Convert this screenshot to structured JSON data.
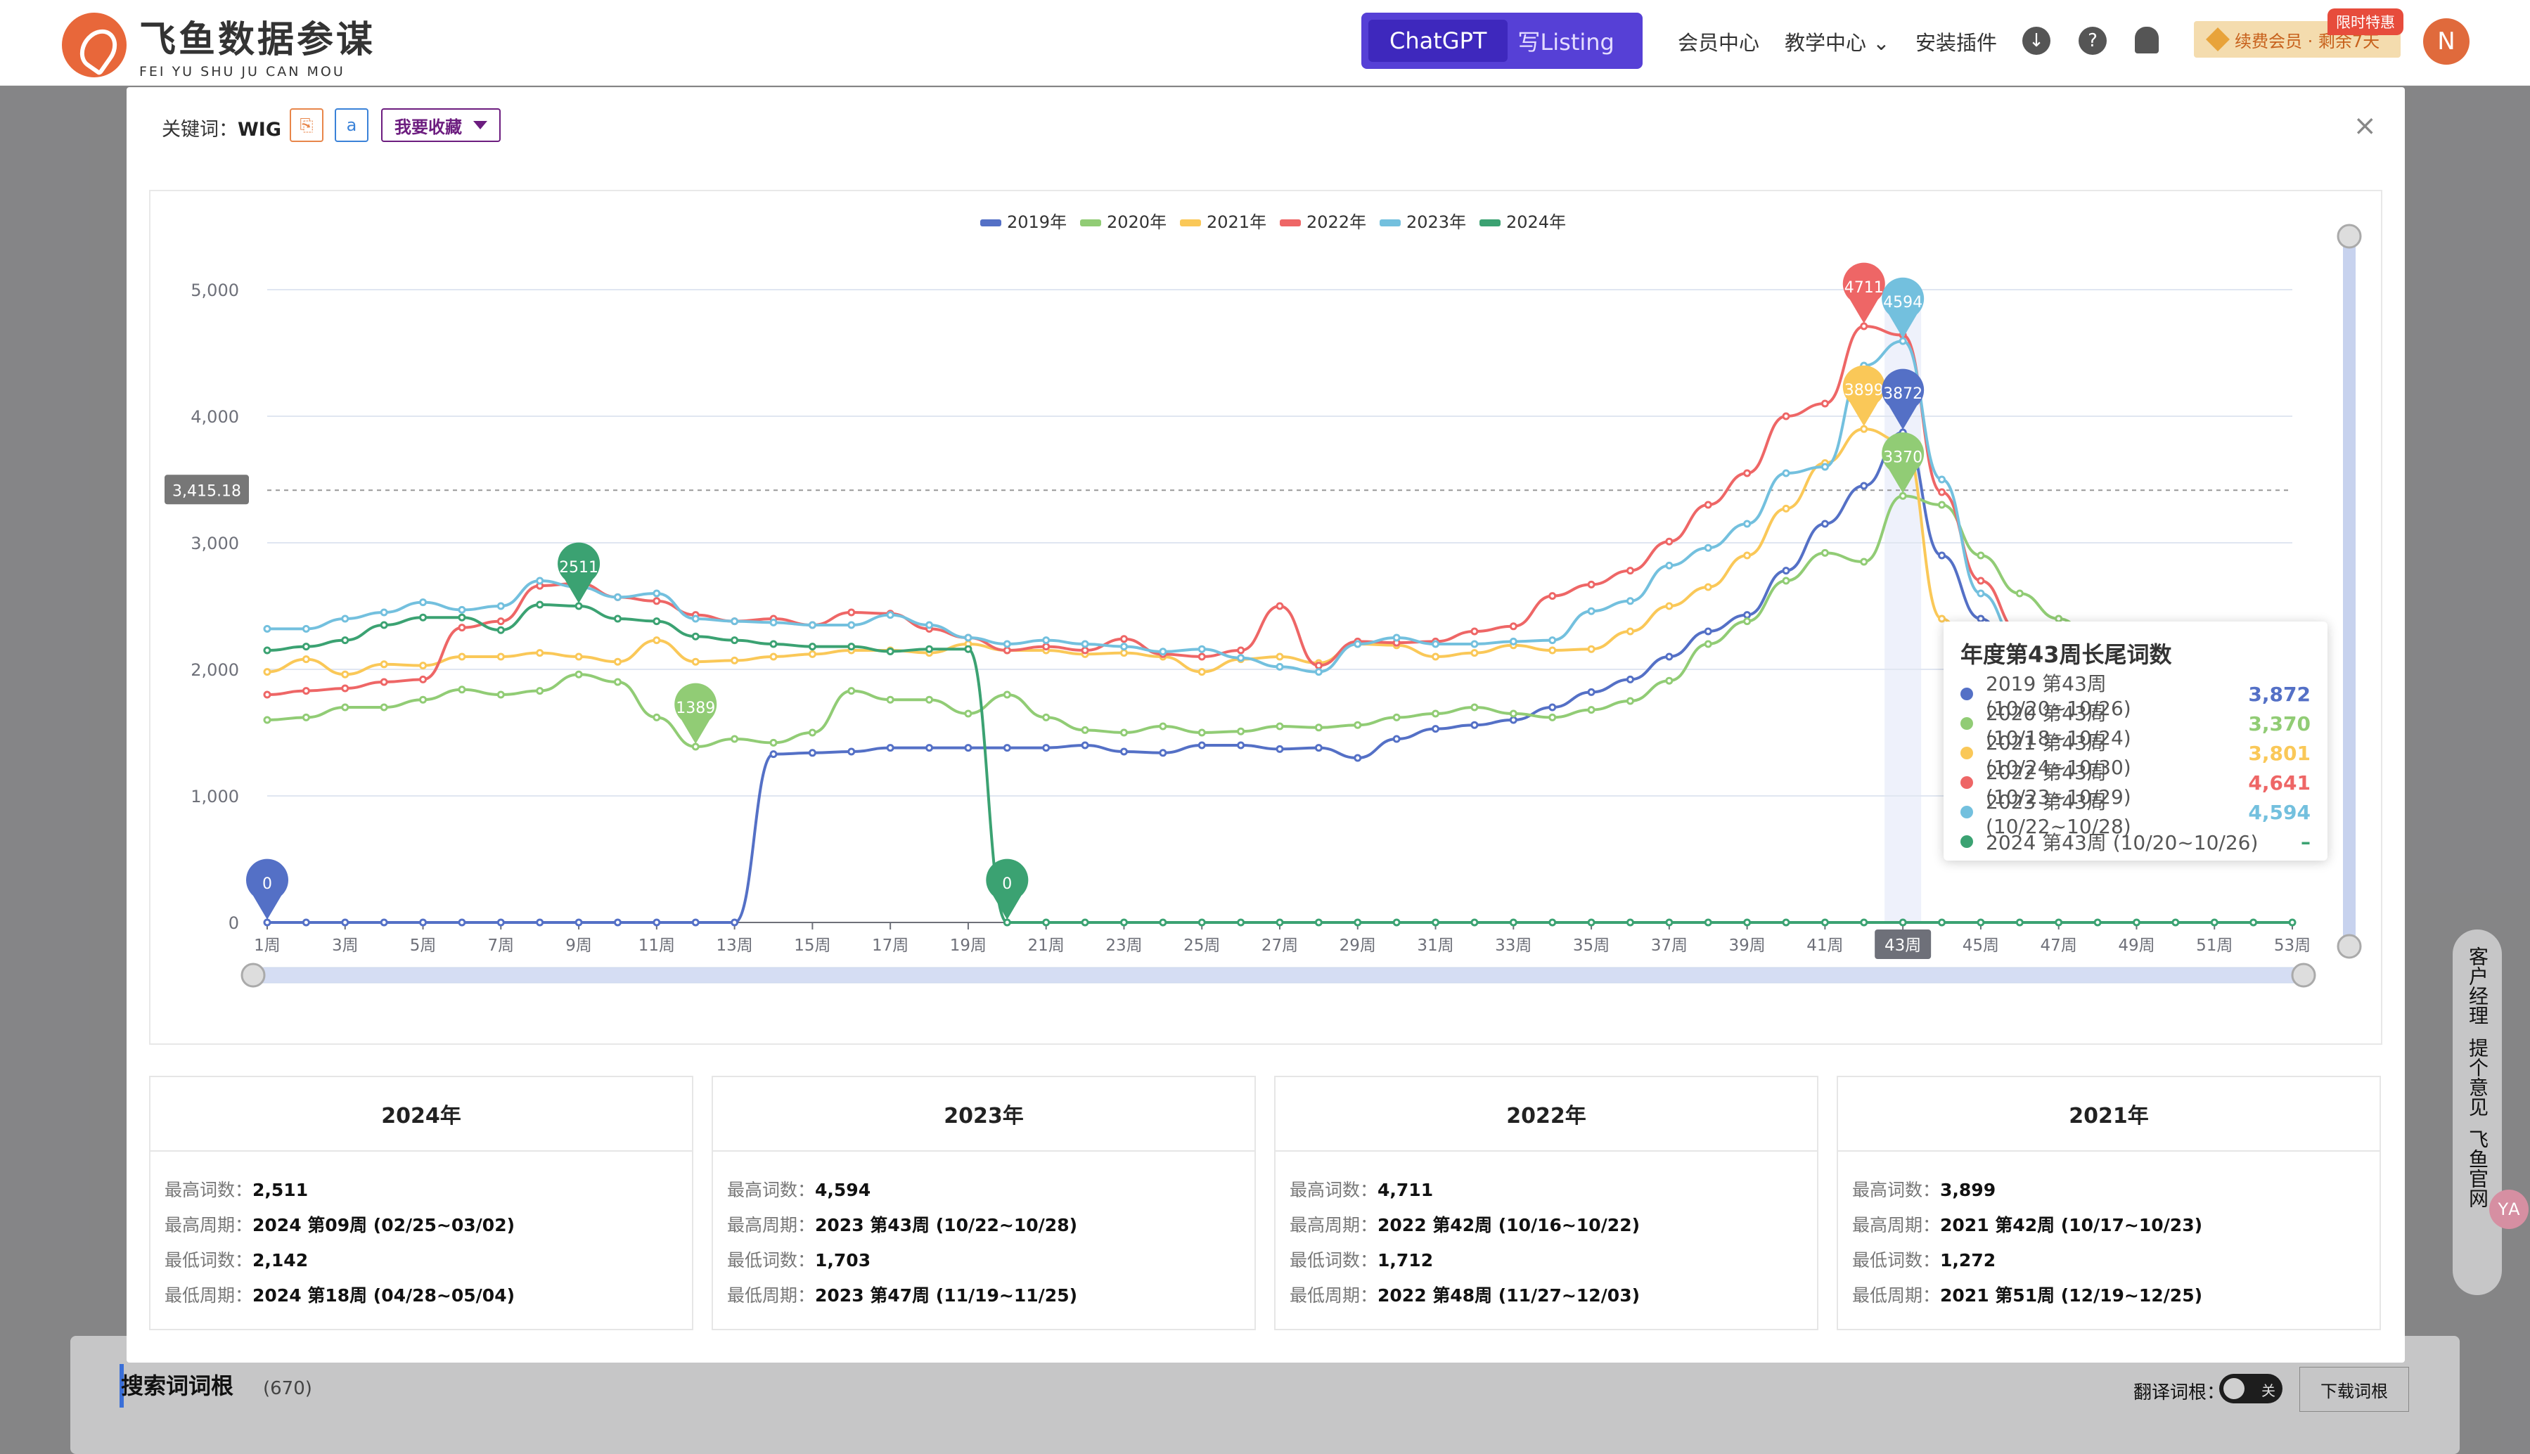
{
  "header": {
    "logo_main": "飞鱼数据参谋",
    "logo_sub": "FEI YU SHU JU CAN MOU",
    "gpt_tab": "ChatGPT",
    "listing_tab": "写Listing",
    "nav": [
      "会员中心",
      "教学中心",
      "安装插件"
    ],
    "vip_text": "续费会员 · 剩余7天",
    "limit_tag": "限时特惠",
    "avatar_letter": "N"
  },
  "background": {
    "section_title": "搜索词词根",
    "section_count": "(670)",
    "toggle_label": "翻译词根：",
    "toggle_state": "关",
    "download_btn": "下载词根",
    "side_float": [
      "客户经理",
      "提个意见",
      "飞鱼官网"
    ],
    "side_cat": "ΥA"
  },
  "modal": {
    "kw_label": "关键词：",
    "keyword": "WIG",
    "icon_copy": "⎘",
    "icon_amazon": "a",
    "fav_label": "我要收藏",
    "close": "×"
  },
  "chart_data": {
    "type": "line",
    "series_names": [
      "2019年",
      "2020年",
      "2021年",
      "2022年",
      "2023年",
      "2024年"
    ],
    "colors": [
      "#5470c6",
      "#91cc75",
      "#fac858",
      "#ee6666",
      "#73c0de",
      "#3ba272"
    ],
    "x": [
      "1周",
      "2周",
      "3周",
      "4周",
      "5周",
      "6周",
      "7周",
      "8周",
      "9周",
      "10周",
      "11周",
      "12周",
      "13周",
      "14周",
      "15周",
      "16周",
      "17周",
      "18周",
      "19周",
      "20周",
      "21周",
      "22周",
      "23周",
      "24周",
      "25周",
      "26周",
      "27周",
      "28周",
      "29周",
      "30周",
      "31周",
      "32周",
      "33周",
      "34周",
      "35周",
      "36周",
      "37周",
      "38周",
      "39周",
      "40周",
      "41周",
      "42周",
      "43周",
      "44周",
      "45周",
      "46周",
      "47周",
      "48周",
      "49周",
      "50周",
      "51周",
      "52周",
      "53周"
    ],
    "x_labels_shown": [
      "1周",
      "3周",
      "5周",
      "7周",
      "9周",
      "11周",
      "13周",
      "15周",
      "17周",
      "19周",
      "21周",
      "23周",
      "25周",
      "27周",
      "29周",
      "31周",
      "33周",
      "35周",
      "37周",
      "39周",
      "41周",
      "43周",
      "45周",
      "47周",
      "49周",
      "51周",
      "53周"
    ],
    "y_ticks": [
      "0",
      "1,000",
      "2,000",
      "3,000",
      "4,000",
      "5,000"
    ],
    "ylim": [
      0,
      5000
    ],
    "reference_line": {
      "value": 3415.18,
      "label": "3,415.18"
    },
    "highlight_x": "43周",
    "series": [
      {
        "name": "2019年",
        "values": [
          0,
          0,
          0,
          0,
          0,
          0,
          0,
          0,
          0,
          0,
          0,
          0,
          0,
          1330,
          1340,
          1350,
          1380,
          1380,
          1380,
          1380,
          1380,
          1400,
          1350,
          1340,
          1400,
          1400,
          1370,
          1380,
          1300,
          1450,
          1530,
          1560,
          1600,
          1700,
          1820,
          1920,
          2100,
          2300,
          2430,
          2780,
          3150,
          3450,
          3872,
          2900,
          2400,
          2000,
          1600,
          1400,
          1300,
          1280,
          1260,
          1320,
          1400
        ]
      },
      {
        "name": "2020年",
        "values": [
          1600,
          1620,
          1700,
          1700,
          1760,
          1840,
          1800,
          1830,
          1960,
          1900,
          1620,
          1389,
          1450,
          1420,
          1500,
          1830,
          1760,
          1760,
          1650,
          1800,
          1620,
          1520,
          1500,
          1550,
          1500,
          1510,
          1550,
          1540,
          1560,
          1620,
          1650,
          1700,
          1650,
          1620,
          1680,
          1750,
          1910,
          2200,
          2380,
          2700,
          2920,
          2850,
          3370,
          3300,
          2900,
          2600,
          2400,
          2200,
          2000,
          1800,
          1600,
          1500,
          1450
        ]
      },
      {
        "name": "2021年",
        "values": [
          1980,
          2080,
          1960,
          2040,
          2030,
          2100,
          2100,
          2130,
          2100,
          2060,
          2230,
          2060,
          2070,
          2100,
          2120,
          2150,
          2150,
          2130,
          2200,
          2150,
          2150,
          2120,
          2130,
          2100,
          1980,
          2080,
          2100,
          2050,
          2200,
          2190,
          2100,
          2130,
          2190,
          2150,
          2160,
          2300,
          2500,
          2650,
          2900,
          3270,
          3630,
          3899,
          3801,
          2400,
          1900,
          1600,
          1500,
          1400,
          1350,
          1320,
          1272,
          1300,
          1350
        ]
      },
      {
        "name": "2022年",
        "values": [
          1800,
          1830,
          1850,
          1900,
          1920,
          2330,
          2380,
          2660,
          2680,
          2570,
          2540,
          2430,
          2380,
          2400,
          2350,
          2450,
          2440,
          2320,
          2250,
          2150,
          2180,
          2150,
          2240,
          2120,
          2100,
          2150,
          2500,
          2030,
          2220,
          2210,
          2220,
          2300,
          2340,
          2580,
          2670,
          2780,
          3010,
          3300,
          3550,
          4000,
          4100,
          4711,
          4641,
          3400,
          2700,
          2300,
          2000,
          1712,
          1800,
          1900,
          2000,
          2100,
          2150
        ]
      },
      {
        "name": "2023年",
        "values": [
          2320,
          2320,
          2400,
          2450,
          2530,
          2470,
          2500,
          2700,
          2650,
          2570,
          2600,
          2400,
          2380,
          2370,
          2350,
          2350,
          2430,
          2350,
          2250,
          2200,
          2230,
          2200,
          2180,
          2140,
          2160,
          2090,
          2020,
          1980,
          2200,
          2250,
          2200,
          2200,
          2220,
          2230,
          2460,
          2540,
          2820,
          2960,
          3150,
          3550,
          3600,
          4400,
          4594,
          3500,
          2600,
          2200,
          1703,
          1900,
          2000,
          2100,
          2200,
          2250,
          2300
        ]
      },
      {
        "name": "2024年",
        "values": [
          2150,
          2180,
          2230,
          2350,
          2410,
          2410,
          2310,
          2511,
          2500,
          2400,
          2380,
          2260,
          2230,
          2200,
          2180,
          2180,
          2142,
          2160,
          2160,
          0,
          0,
          0,
          0,
          0,
          0,
          0,
          0,
          0,
          0,
          0,
          0,
          0,
          0,
          0,
          0,
          0,
          0,
          0,
          0,
          0,
          0,
          0,
          0,
          0,
          0,
          0,
          0,
          0,
          0,
          0,
          0,
          0,
          0
        ]
      }
    ],
    "markers": [
      {
        "series": "2019年",
        "x": "1周",
        "label": "0"
      },
      {
        "series": "2024年",
        "x": "9周",
        "label": "2511"
      },
      {
        "series": "2020年",
        "x": "12周",
        "label": "1389"
      },
      {
        "series": "2024年",
        "x": "20周",
        "label": "0"
      },
      {
        "series": "2022年",
        "x": "42周",
        "label": "4711"
      },
      {
        "series": "2021年",
        "x": "42周",
        "label": "3899"
      },
      {
        "series": "2023年",
        "x": "43周",
        "label": "4594"
      },
      {
        "series": "2019年",
        "x": "43周",
        "label": "3872"
      },
      {
        "series": "2020年",
        "x": "43周",
        "label": "3370"
      }
    ]
  },
  "tooltip": {
    "title": "年度第43周长尾词数",
    "rows": [
      {
        "name": "2019 第43周 (10/20~10/26)",
        "value": "3,872",
        "color": "#5470c6"
      },
      {
        "name": "2020 第43周 (10/18~10/24)",
        "value": "3,370",
        "color": "#91cc75"
      },
      {
        "name": "2021 第43周 (10/24~10/30)",
        "value": "3,801",
        "color": "#fac858"
      },
      {
        "name": "2022 第43周 (10/23~10/29)",
        "value": "4,641",
        "color": "#ee6666"
      },
      {
        "name": "2023 第43周 (10/22~10/28)",
        "value": "4,594",
        "color": "#73c0de"
      },
      {
        "name": "2024 第43周 (10/20~10/26)",
        "value": "–",
        "color": "#3ba272"
      }
    ]
  },
  "cards": [
    {
      "year": "2024年",
      "max_label": "最高词数：",
      "max": "2,511",
      "max_week_label": "最高周期：",
      "max_week": "2024 第09周 (02/25~03/02)",
      "min_label": "最低词数：",
      "min": "2,142",
      "min_week_label": "最低周期：",
      "min_week": "2024 第18周 (04/28~05/04)"
    },
    {
      "year": "2023年",
      "max_label": "最高词数：",
      "max": "4,594",
      "max_week_label": "最高周期：",
      "max_week": "2023 第43周 (10/22~10/28)",
      "min_label": "最低词数：",
      "min": "1,703",
      "min_week_label": "最低周期：",
      "min_week": "2023 第47周 (11/19~11/25)"
    },
    {
      "year": "2022年",
      "max_label": "最高词数：",
      "max": "4,711",
      "max_week_label": "最高周期：",
      "max_week": "2022 第42周 (10/16~10/22)",
      "min_label": "最低词数：",
      "min": "1,712",
      "min_week_label": "最低周期：",
      "min_week": "2022 第48周 (11/27~12/03)"
    },
    {
      "year": "2021年",
      "max_label": "最高词数：",
      "max": "3,899",
      "max_week_label": "最高周期：",
      "max_week": "2021 第42周 (10/17~10/23)",
      "min_label": "最低词数：",
      "min": "1,272",
      "min_week_label": "最低周期：",
      "min_week": "2021 第51周 (12/19~12/25)"
    }
  ]
}
